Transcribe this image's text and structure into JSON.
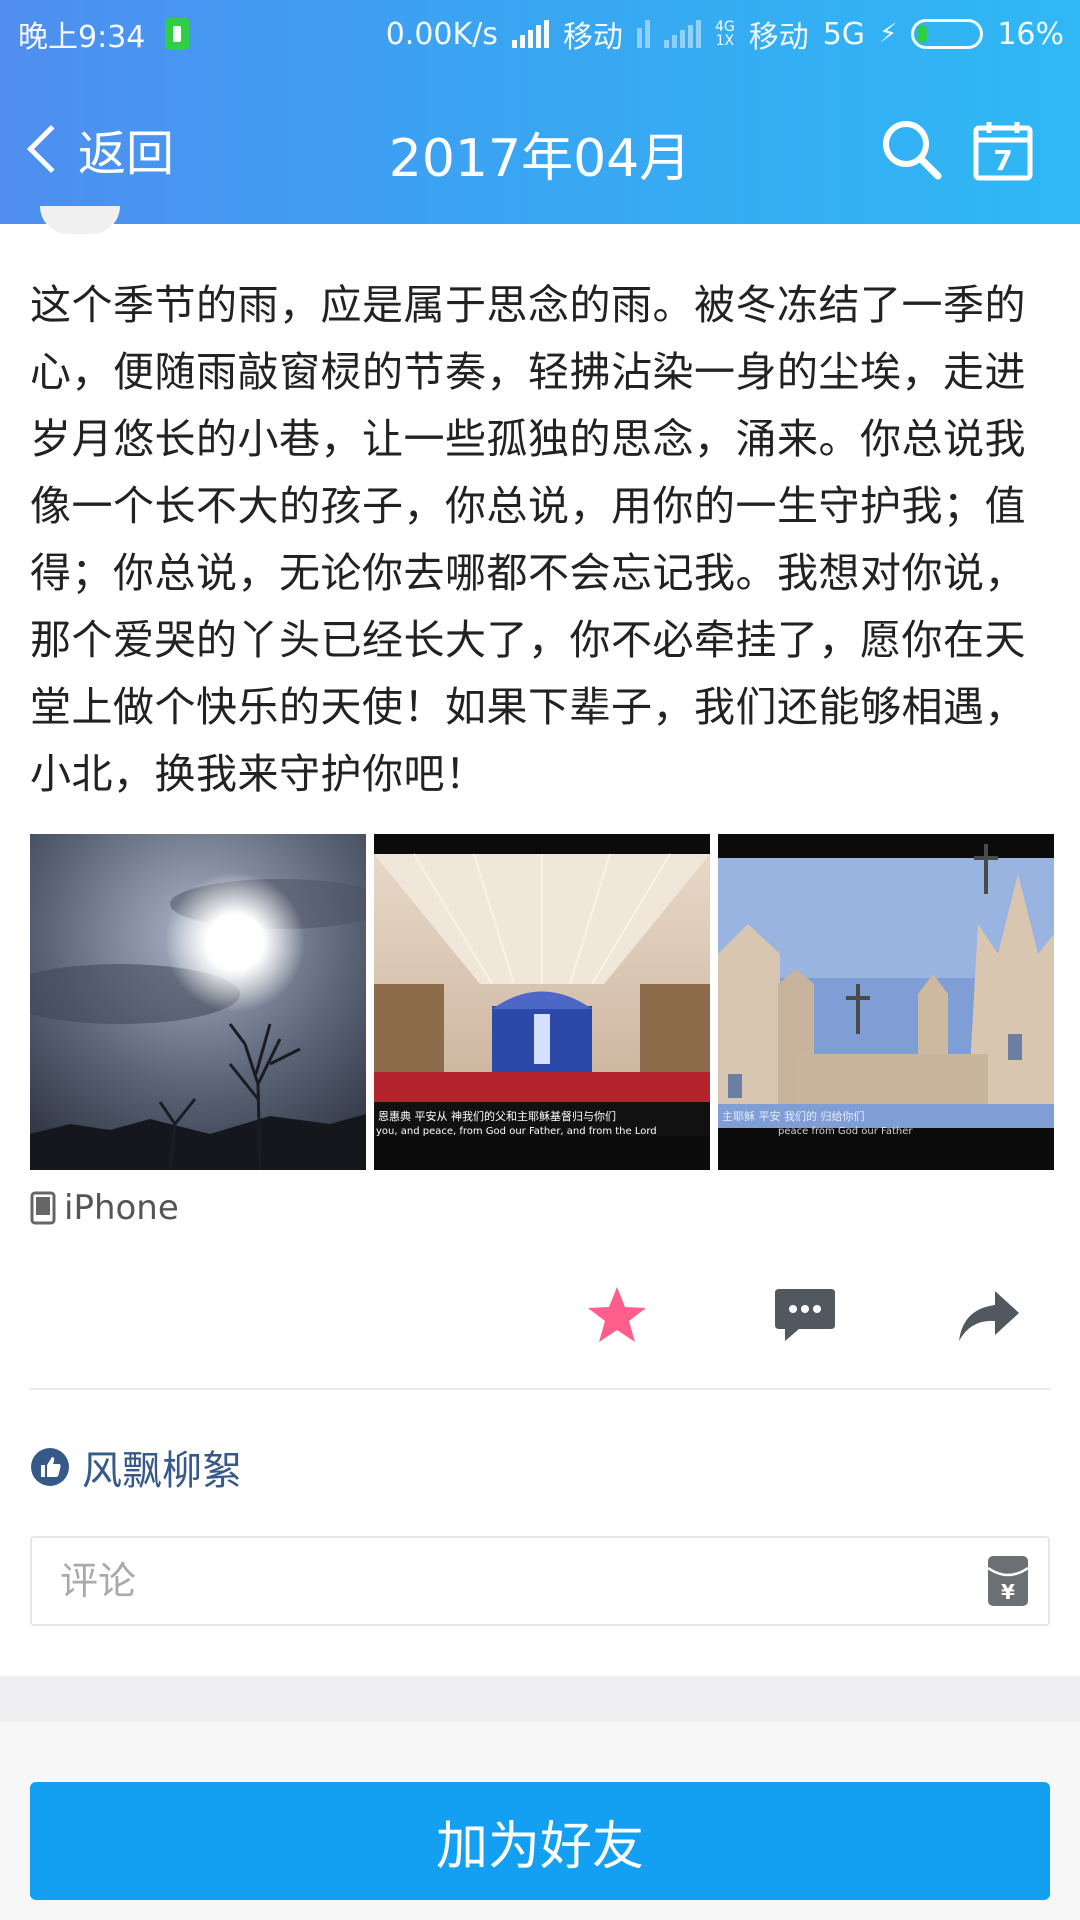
{
  "status_bar": {
    "time": "晚上9:34",
    "speed": "0.00K/s",
    "carrier1": "移动",
    "carrier2": "移动",
    "net_small_top": "4G",
    "net_small_bottom": "1X",
    "network": "5G",
    "battery": "16%"
  },
  "nav": {
    "back_label": "返回",
    "title": "2017年04月",
    "calendar_day": "7"
  },
  "post": {
    "text": "这个季节的雨，应是属于思念的雨。被冬冻结了一季的心，便随雨敲窗棂的节奏，轻拂沾染一身的尘埃，走进岁月悠长的小巷，让一些孤独的思念，涌来。你总说我像一个长不大的孩子，你总说，用你的一生守护我；值得；你总说，无论你去哪都不会忘记我。我想对你说，那个爱哭的丫头已经长大了，你不必牵挂了，愿你在天堂上做个快乐的天使！如果下辈子，我们还能够相遇，小北，换我来守护你吧！",
    "photos": [
      {
        "caption_cn": "",
        "caption_en": ""
      },
      {
        "caption_cn": "恩惠典  平安从    神我们的父和主耶稣基督归与你们",
        "caption_en": "you, and peace, from God our Father, and from the Lord"
      },
      {
        "caption_cn": "主耶稣 平安 我们的 归给你们",
        "caption_en": "peace from God our Father"
      }
    ],
    "device": "iPhone"
  },
  "colors": {
    "header_start": "#4f8ef0",
    "header_end": "#2fb8f5",
    "star": "#ff5d8a",
    "like_name": "#36598a",
    "primary_button": "#14a0f2"
  },
  "likes": {
    "names": "风飘柳絮"
  },
  "comment": {
    "placeholder": "评论"
  },
  "footer": {
    "add_friend_label": "加为好友"
  }
}
